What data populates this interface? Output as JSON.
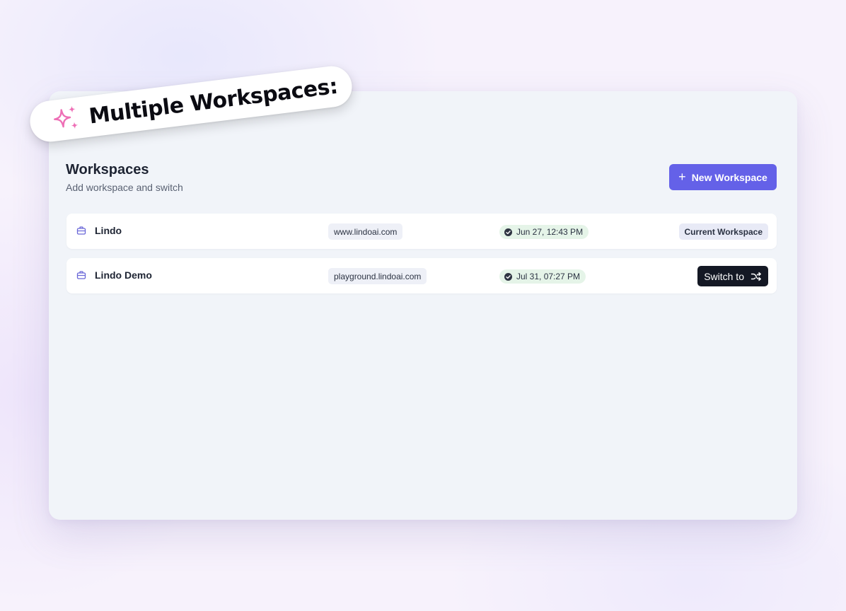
{
  "feature_label": "Multiple Workspaces:",
  "header": {
    "title": "Workspaces",
    "subtitle": "Add workspace and switch",
    "new_button_label": "New Workspace"
  },
  "workspaces": [
    {
      "name": "Lindo",
      "domain": "www.lindoai.com",
      "date": "Jun 27, 12:43 PM",
      "status_label": "Current Workspace"
    },
    {
      "name": "Lindo Demo",
      "domain": "playground.lindoai.com",
      "date": "Jul 31, 07:27 PM",
      "action_label": "Switch to"
    }
  ],
  "icons": {
    "sparkle": "sparkle-icon",
    "plus": "plus-icon",
    "workspace": "briefcase-icon",
    "verified": "check-circle-icon",
    "switch": "shuffle-icon"
  },
  "colors": {
    "accent": "#6461e8",
    "sparkle": "#ee6fb6",
    "dark_button": "#141824",
    "date_badge_bg": "#e5f4e8",
    "card_bg": "#f1f4f9"
  }
}
